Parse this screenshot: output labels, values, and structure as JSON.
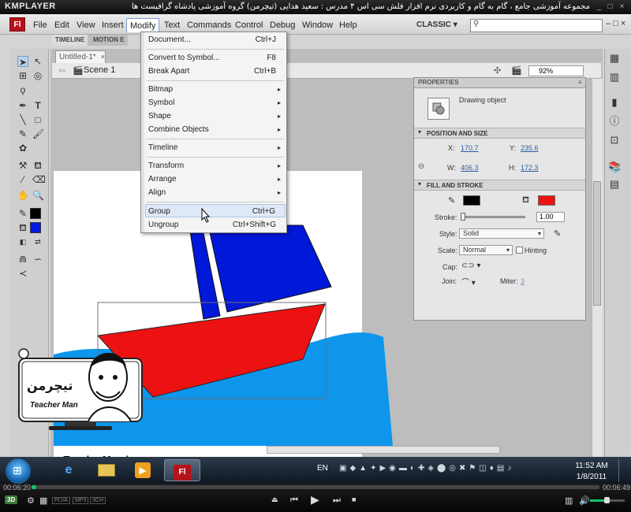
{
  "kmplayer": {
    "logo": "KMPLAYER",
    "title": "مجموعه آموزشی جامع ، گام به گام و کاربردی نرم افزار فلش سی اس ۴ مدرس : سعید هدایی (تیچرمن) گروه آموزشی پادشاه گرافیست ها",
    "time_elapsed": "00:06:20",
    "time_total": "00:06:49",
    "controls": [
      "eject",
      "prev",
      "play",
      "next",
      "stop"
    ],
    "badges": [
      "PLVA",
      "MP3",
      "3CH"
    ],
    "left_badge": "3D"
  },
  "flash": {
    "logo": "Fl",
    "menus": [
      "File",
      "Edit",
      "View",
      "Insert",
      "Modify",
      "Text",
      "Commands",
      "Control",
      "Debug",
      "Window",
      "Help"
    ],
    "workspace": "CLASSIC",
    "search_placeholder": "",
    "panel_tabs": [
      "TIMELINE",
      "MOTION E"
    ],
    "doc_tab": "Untitled-1*",
    "scene": "Scene 1",
    "zoom": "92%"
  },
  "modify_menu": {
    "items": [
      {
        "label": "Document...",
        "shortcut": "Ctrl+J"
      },
      {
        "label": "Convert to Symbol...",
        "shortcut": "F8"
      },
      {
        "label": "Break Apart",
        "shortcut": "Ctrl+B"
      },
      {
        "label": "Bitmap",
        "submenu": "▸"
      },
      {
        "label": "Symbol",
        "submenu": "▸"
      },
      {
        "label": "Shape",
        "submenu": "▸"
      },
      {
        "label": "Combine Objects",
        "submenu": "▸"
      },
      {
        "label": "Timeline",
        "submenu": "▸"
      },
      {
        "label": "Transform",
        "submenu": "▸"
      },
      {
        "label": "Arrange",
        "submenu": "▸"
      },
      {
        "label": "Align",
        "submenu": "▸"
      },
      {
        "label": "Group",
        "shortcut": "Ctrl+G"
      },
      {
        "label": "Ungroup",
        "shortcut": "Ctrl+Shift+G"
      }
    ]
  },
  "properties": {
    "title": "PROPERTIES",
    "object_type": "Drawing object",
    "position_section": "POSITION AND SIZE",
    "x_label": "X:",
    "x": "170.7",
    "y_label": "Y:",
    "y": "235.6",
    "w_label": "W:",
    "w": "406.3",
    "h_label": "H:",
    "h": "172.3",
    "fill_section": "FILL AND STROKE",
    "stroke_color": "#000000",
    "fill_color": "#ee1111",
    "stroke_label": "Stroke:",
    "stroke_value": "1.00",
    "style_label": "Style:",
    "style_value": "Solid",
    "scale_label": "Scale:",
    "scale_value": "Normal",
    "hinting_label": "Hinting",
    "cap_label": "Cap:",
    "join_label": "Join:",
    "miter_label": "Miter:",
    "miter_value": "3"
  },
  "tools": {
    "stroke_color": "#000000",
    "fill_color": "#0018e6"
  },
  "taskbar": {
    "lang": "EN",
    "time": "11:52 AM",
    "date": "1/8/2011",
    "app_label": "Fl"
  },
  "overlay": {
    "name_fa": "تیچرمن",
    "name_en": "Teacher Man",
    "url": "www.TeacherMan.ir"
  }
}
